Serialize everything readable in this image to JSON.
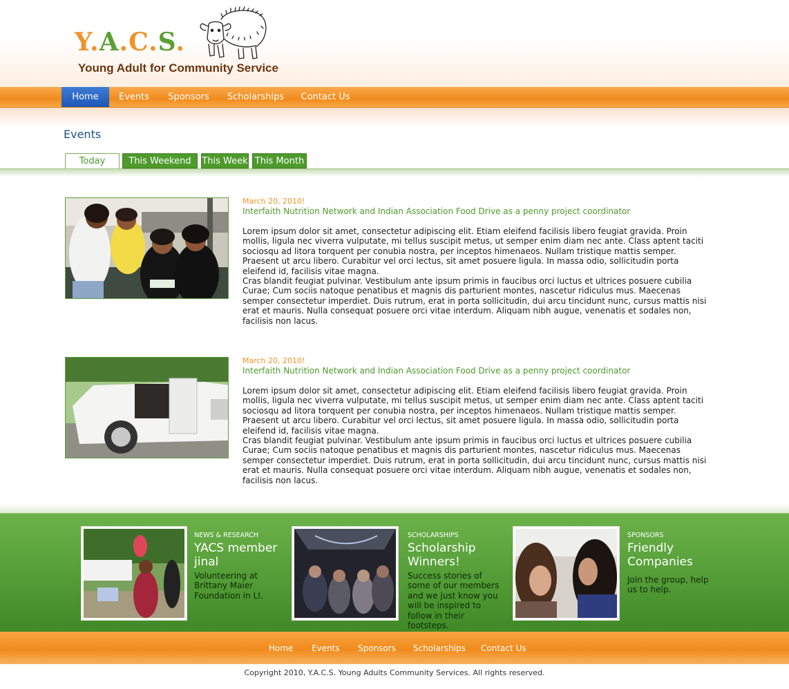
{
  "header": {
    "logo_letters": [
      "Y",
      ".",
      "A",
      ".",
      "C",
      ".",
      "S",
      "."
    ],
    "subtitle": "Young Adult for Community Service",
    "mascot_icon": "musk-ox-icon"
  },
  "nav": {
    "items": [
      "Home",
      "Events",
      "Sponsors",
      "Scholarships",
      "Contact Us"
    ],
    "active": "Home"
  },
  "events_section": {
    "title": "Events",
    "tabs": [
      "Today",
      "This Weekend",
      "This Week",
      "This Month"
    ],
    "active_tab": "Today"
  },
  "events": [
    {
      "date": "March 20, 2010!",
      "title": "Interfaith Nutrition Network and Indian Association Food Drive as a penny project coordinator",
      "para1": "Lorem ipsum dolor sit amet, consectetur adipiscing elit. Etiam eleifend facilisis libero feugiat gravida. Proin mollis, ligula nec viverra vulputate, mi tellus suscipit metus, ut semper enim diam nec ante. Class aptent taciti sociosqu ad litora torquent per conubia nostra, per inceptos himenaeos. Nullam tristique mattis semper. Praesent ut arcu libero. Curabitur vel orci lectus, sit amet posuere ligula. In massa odio, sollicitudin porta eleifend id, facilisis vitae magna.",
      "para2": "Cras blandit feugiat pulvinar. Vestibulum ante ipsum primis in faucibus orci luctus et ultrices posuere cubilia Curae; Cum sociis natoque penatibus et magnis dis parturient montes, nascetur ridiculus mus. Maecenas semper consectetur imperdiet. Duis rutrum, erat in porta sollicitudin, dui arcu tincidunt nunc, cursus mattis nisi erat et mauris. Nulla consequat posuere orci vitae interdum. Aliquam nibh augue, venenatis et sodales non, facilisis non lacus."
    },
    {
      "date": "March 20, 2010!",
      "title": "Interfaith Nutrition Network and Indian Association Food Drive as a penny project coordinator",
      "para1": "Lorem ipsum dolor sit amet, consectetur adipiscing elit. Etiam eleifend facilisis libero feugiat gravida. Proin mollis, ligula nec viverra vulputate, mi tellus suscipit metus, ut semper enim diam nec ante. Class aptent taciti sociosqu ad litora torquent per conubia nostra, per inceptos himenaeos. Nullam tristique mattis semper. Praesent ut arcu libero. Curabitur vel orci lectus, sit amet posuere ligula. In massa odio, sollicitudin porta eleifend id, facilisis vitae magna.",
      "para2": "Cras blandit feugiat pulvinar. Vestibulum ante ipsum primis in faucibus orci luctus et ultrices posuere cubilia Curae; Cum sociis natoque penatibus et magnis dis parturient montes, nascetur ridiculus mus. Maecenas semper consectetur imperdiet. Duis rutrum, erat in porta sollicitudin, dui arcu tincidunt nunc, cursus mattis nisi erat et mauris. Nulla consequat posuere orci vitae interdum. Aliquam nibh augue, venenatis et sodales non, facilisis non lacus."
    }
  ],
  "promos": [
    {
      "kicker": "NEWS & RESEARCH",
      "headline": "YACS member jinal",
      "body": "Volunteering at Brittany Maier Foundation in LI."
    },
    {
      "kicker": "SCHOLARSHIPS",
      "headline": "Scholarship Winners!",
      "body": "Success stories of some of our members and we just know you will be inspired to follow in their footsteps."
    },
    {
      "kicker": "SPONSORS",
      "headline": "Friendly Companies",
      "body": "Join the group, help us to help."
    }
  ],
  "footer": {
    "nav": [
      "Home",
      "Events",
      "Sponsors",
      "Scholarships",
      "Contact Us"
    ],
    "copyright": "Copyright 2010, Y.A.C.S. Young Adults Community Services. All rights reserved."
  },
  "colors": {
    "orange": "#f0932a",
    "green": "#4e9a2c",
    "blue_active": "#1d57b4",
    "title_blue": "#1e4f8a"
  }
}
